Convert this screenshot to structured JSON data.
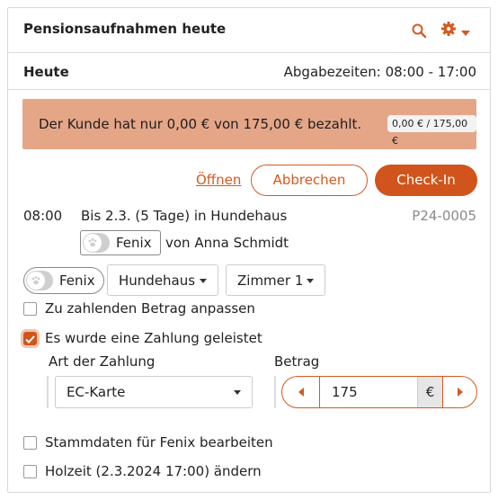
{
  "header": {
    "title": "Pensionsaufnahmen heute",
    "search_icon": "search-icon",
    "settings_icon": "gear-icon",
    "accent": "#d35a1f"
  },
  "subheader": {
    "title": "Heute",
    "dropoff_times": "Abgabezeiten: 08:00 - 17:00"
  },
  "alert": {
    "message": "Der Kunde hat nur 0,00 € von 175,00 € bezahlt.",
    "badge": "0,00 € / 175,00 €",
    "color": "#e5a688"
  },
  "actions": {
    "open_label": "Öffnen",
    "cancel_label": "Abbrechen",
    "checkin_label": "Check-In"
  },
  "booking": {
    "time": "08:00",
    "description": "Bis 2.3. (5 Tage) in Hundehaus",
    "reference": "P24-0005",
    "pet_name": "Fenix",
    "owner": "von Anna Schmidt"
  },
  "assignment": {
    "pet_name": "Fenix",
    "house": "Hundehaus",
    "room": "Zimmer 1"
  },
  "options": {
    "adjust_amount_label": "Zu zahlenden Betrag anpassen",
    "adjust_amount_checked": false,
    "payment_made_label": "Es wurde eine Zahlung geleistet",
    "payment_made_checked": true
  },
  "payment": {
    "method_label": "Art der Zahlung",
    "method_value": "EC-Karte",
    "amount_label": "Betrag",
    "amount_value": "175",
    "currency": "€"
  },
  "footer_options": {
    "edit_master_data_label": "Stammdaten für Fenix bearbeiten",
    "edit_master_data_checked": false,
    "change_pickup_label": "Holzeit (2.3.2024 17:00) ändern",
    "change_pickup_checked": false
  }
}
